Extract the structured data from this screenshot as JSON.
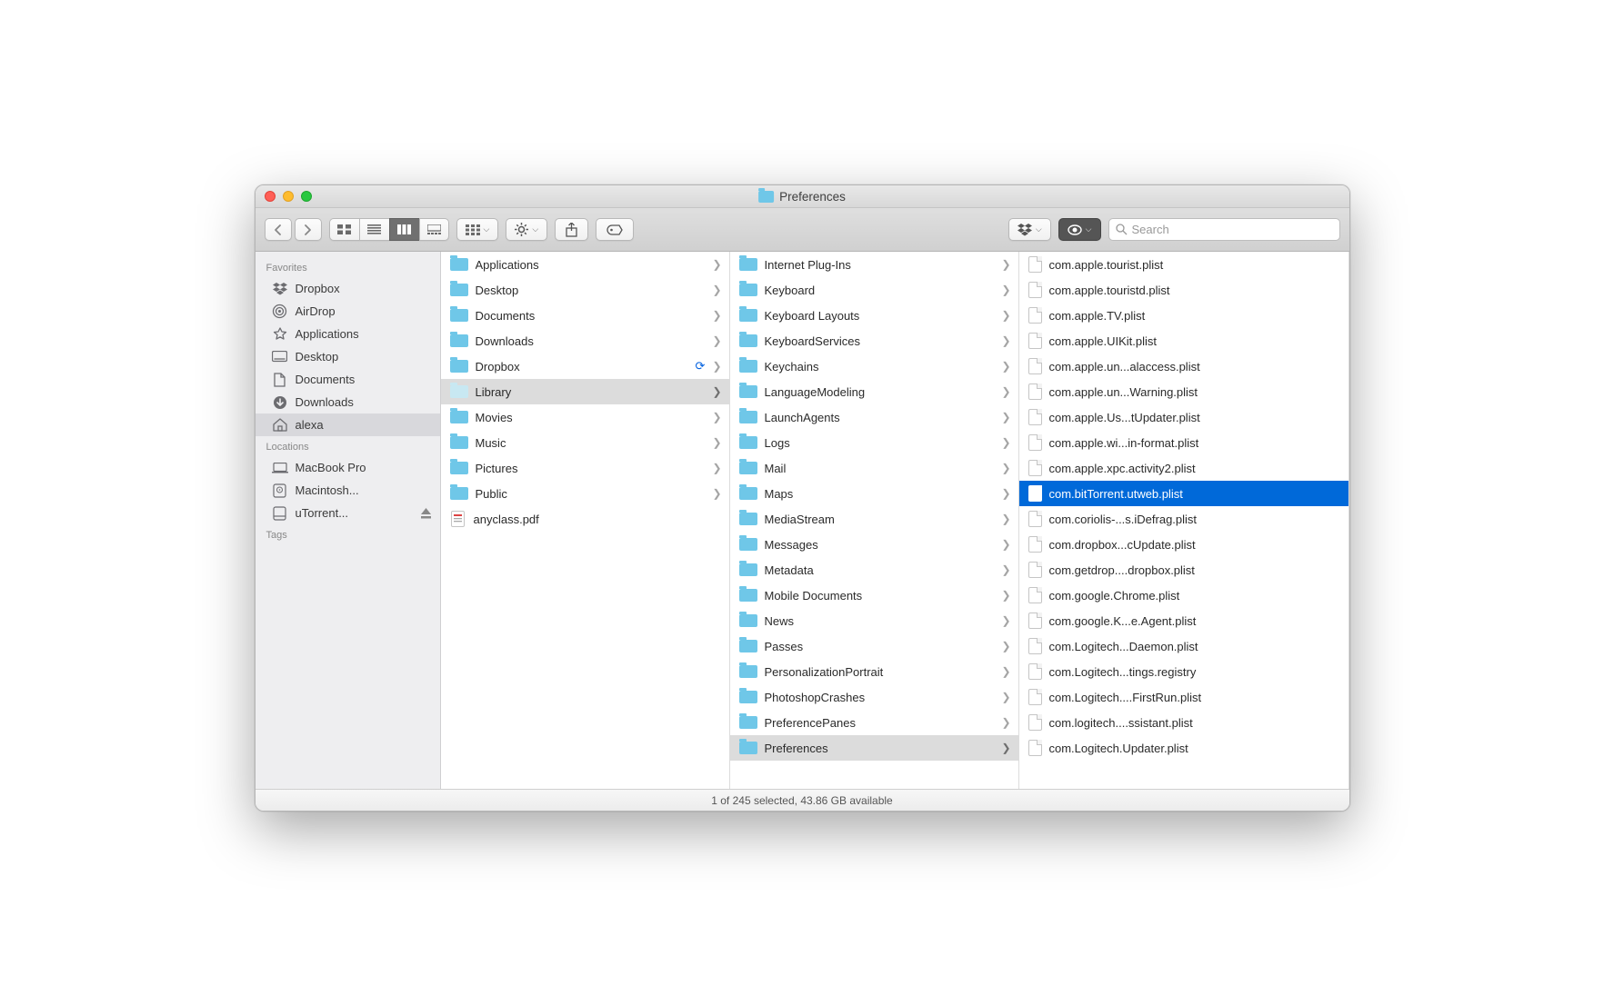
{
  "window": {
    "title": "Preferences"
  },
  "search": {
    "placeholder": "Search"
  },
  "sidebar": {
    "sections": [
      {
        "label": "Favorites",
        "items": [
          {
            "icon": "dropbox",
            "label": "Dropbox"
          },
          {
            "icon": "airdrop",
            "label": "AirDrop"
          },
          {
            "icon": "apps",
            "label": "Applications"
          },
          {
            "icon": "desktop",
            "label": "Desktop"
          },
          {
            "icon": "documents",
            "label": "Documents"
          },
          {
            "icon": "downloads",
            "label": "Downloads"
          },
          {
            "icon": "home",
            "label": "alexa",
            "selected": true
          }
        ]
      },
      {
        "label": "Locations",
        "items": [
          {
            "icon": "laptop",
            "label": "MacBook Pro"
          },
          {
            "icon": "hdd",
            "label": "Macintosh..."
          },
          {
            "icon": "disk",
            "label": "uTorrent...",
            "eject": true
          }
        ]
      },
      {
        "label": "Tags",
        "items": []
      }
    ]
  },
  "columns": [
    {
      "items": [
        {
          "type": "folder",
          "label": "Applications",
          "arrow": true
        },
        {
          "type": "folder",
          "label": "Desktop",
          "arrow": true
        },
        {
          "type": "folder",
          "label": "Documents",
          "arrow": true
        },
        {
          "type": "folder",
          "label": "Downloads",
          "arrow": true
        },
        {
          "type": "folder",
          "label": "Dropbox",
          "arrow": true,
          "sync": true
        },
        {
          "type": "folder-faded",
          "label": "Library",
          "arrow": true,
          "selected": "grey"
        },
        {
          "type": "folder",
          "label": "Movies",
          "arrow": true
        },
        {
          "type": "folder",
          "label": "Music",
          "arrow": true
        },
        {
          "type": "folder",
          "label": "Pictures",
          "arrow": true
        },
        {
          "type": "folder",
          "label": "Public",
          "arrow": true
        },
        {
          "type": "pdf",
          "label": "anyclass.pdf"
        }
      ]
    },
    {
      "items": [
        {
          "type": "folder",
          "label": "Internet Plug-Ins",
          "arrow": true
        },
        {
          "type": "folder",
          "label": "Keyboard",
          "arrow": true
        },
        {
          "type": "folder",
          "label": "Keyboard Layouts",
          "arrow": true
        },
        {
          "type": "folder",
          "label": "KeyboardServices",
          "arrow": true
        },
        {
          "type": "folder",
          "label": "Keychains",
          "arrow": true
        },
        {
          "type": "folder",
          "label": "LanguageModeling",
          "arrow": true
        },
        {
          "type": "folder",
          "label": "LaunchAgents",
          "arrow": true
        },
        {
          "type": "folder",
          "label": "Logs",
          "arrow": true
        },
        {
          "type": "folder",
          "label": "Mail",
          "arrow": true
        },
        {
          "type": "folder",
          "label": "Maps",
          "arrow": true
        },
        {
          "type": "folder",
          "label": "MediaStream",
          "arrow": true
        },
        {
          "type": "folder",
          "label": "Messages",
          "arrow": true
        },
        {
          "type": "folder",
          "label": "Metadata",
          "arrow": true
        },
        {
          "type": "folder",
          "label": "Mobile Documents",
          "arrow": true
        },
        {
          "type": "folder",
          "label": "News",
          "arrow": true
        },
        {
          "type": "folder",
          "label": "Passes",
          "arrow": true
        },
        {
          "type": "folder",
          "label": "PersonalizationPortrait",
          "arrow": true
        },
        {
          "type": "folder",
          "label": "PhotoshopCrashes",
          "arrow": true
        },
        {
          "type": "folder",
          "label": "PreferencePanes",
          "arrow": true
        },
        {
          "type": "folder",
          "label": "Preferences",
          "arrow": true,
          "selected": "grey"
        }
      ]
    },
    {
      "items": [
        {
          "type": "file",
          "label": "com.apple.tourist.plist"
        },
        {
          "type": "file",
          "label": "com.apple.touristd.plist"
        },
        {
          "type": "file",
          "label": "com.apple.TV.plist"
        },
        {
          "type": "file",
          "label": "com.apple.UIKit.plist"
        },
        {
          "type": "file",
          "label": "com.apple.un...alaccess.plist"
        },
        {
          "type": "file",
          "label": "com.apple.un...Warning.plist"
        },
        {
          "type": "file",
          "label": "com.apple.Us...tUpdater.plist"
        },
        {
          "type": "file",
          "label": "com.apple.wi...in-format.plist"
        },
        {
          "type": "file",
          "label": "com.apple.xpc.activity2.plist"
        },
        {
          "type": "file",
          "label": "com.bitTorrent.utweb.plist",
          "selected": "blue"
        },
        {
          "type": "file",
          "label": "com.coriolis-...s.iDefrag.plist"
        },
        {
          "type": "file",
          "label": "com.dropbox...cUpdate.plist"
        },
        {
          "type": "file",
          "label": "com.getdrop....dropbox.plist"
        },
        {
          "type": "file",
          "label": "com.google.Chrome.plist"
        },
        {
          "type": "file",
          "label": "com.google.K...e.Agent.plist"
        },
        {
          "type": "file",
          "label": "com.Logitech...Daemon.plist"
        },
        {
          "type": "file",
          "label": "com.Logitech...tings.registry"
        },
        {
          "type": "file",
          "label": "com.Logitech....FirstRun.plist"
        },
        {
          "type": "file",
          "label": "com.logitech....ssistant.plist"
        },
        {
          "type": "file",
          "label": "com.Logitech.Updater.plist"
        }
      ]
    }
  ],
  "status": {
    "text": "1 of 245 selected, 43.86 GB available"
  }
}
